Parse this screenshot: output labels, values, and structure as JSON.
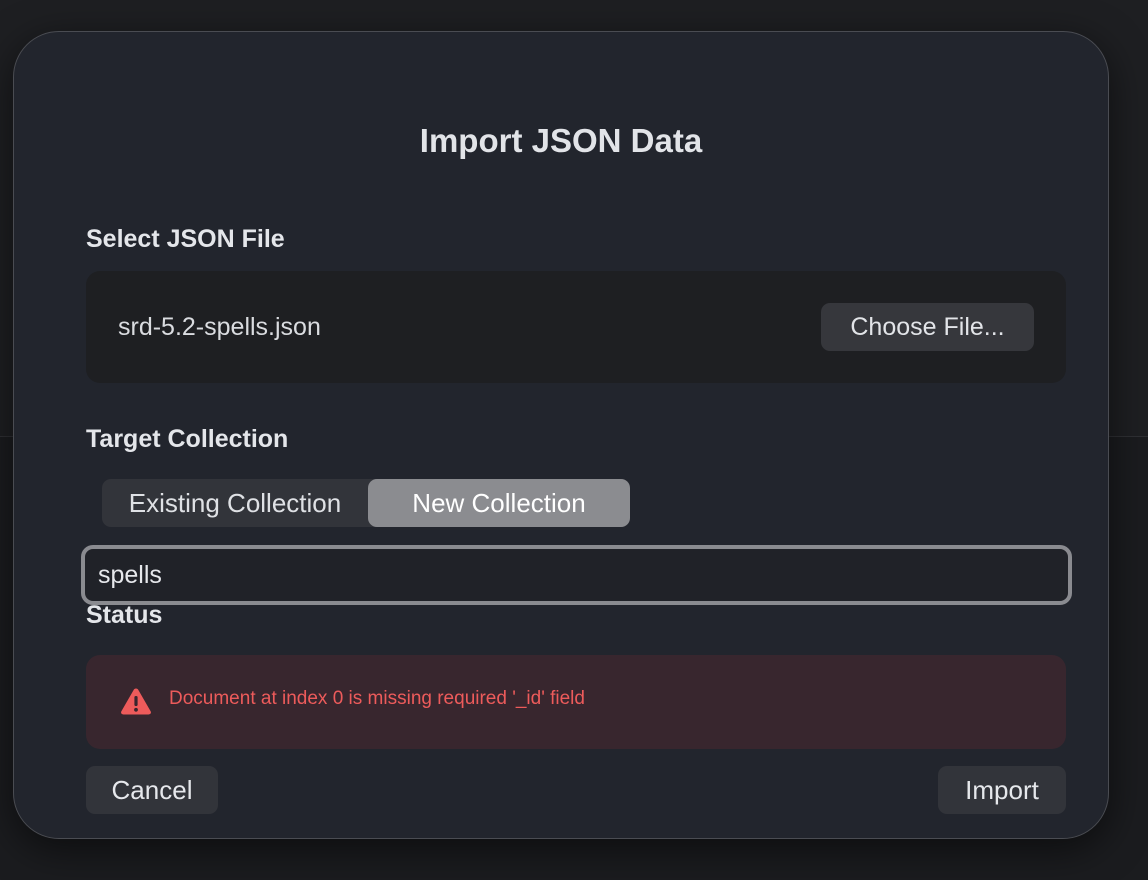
{
  "dialog": {
    "title": "Import JSON Data"
  },
  "file_section": {
    "label": "Select JSON File",
    "file_name": "srd-5.2-spells.json",
    "choose_button_label": "Choose File..."
  },
  "target_section": {
    "label": "Target Collection",
    "segments": [
      {
        "label": "Existing Collection",
        "selected": false
      },
      {
        "label": "New Collection",
        "selected": true
      }
    ],
    "collection_name_value": "spells"
  },
  "status_section": {
    "label": "Status",
    "icon": "warning-triangle-icon",
    "message": "Document at index 0 is missing required '_id' field",
    "message_color": "#ed5b5b"
  },
  "actions": {
    "cancel_label": "Cancel",
    "import_label": "Import"
  },
  "colors": {
    "dialog_background": "#22252d",
    "selected_segment": "#8b8c90",
    "error_background": "#38262e"
  }
}
